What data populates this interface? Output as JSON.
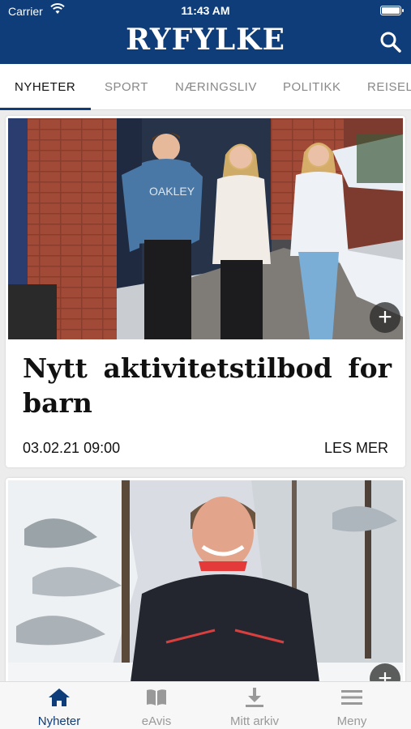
{
  "status_bar": {
    "carrier": "Carrier",
    "time": "11:43 AM"
  },
  "header": {
    "logo": "RYFYLKE",
    "search_icon": "search-icon"
  },
  "tabs": [
    {
      "label": "NYHETER",
      "active": true
    },
    {
      "label": "SPORT",
      "active": false
    },
    {
      "label": "NÆRINGSLIV",
      "active": false
    },
    {
      "label": "POLITIKK",
      "active": false
    },
    {
      "label": "REISELIV",
      "active": false
    }
  ],
  "articles": [
    {
      "headline": "Nytt aktivitetstilbod for barn",
      "date": "03.02.21 09:00",
      "read_more": "LES MER",
      "image_text": "OAKLEY",
      "add_icon": "plus-icon"
    },
    {
      "add_icon": "plus-icon"
    }
  ],
  "bottom_nav": [
    {
      "label": "Nyheter",
      "icon": "home-icon",
      "active": true
    },
    {
      "label": "eAvis",
      "icon": "book-icon",
      "active": false
    },
    {
      "label": "Mitt arkiv",
      "icon": "download-icon",
      "active": false
    },
    {
      "label": "Meny",
      "icon": "menu-icon",
      "active": false
    }
  ],
  "colors": {
    "brand": "#0f3d7a",
    "inactive": "#999999"
  }
}
